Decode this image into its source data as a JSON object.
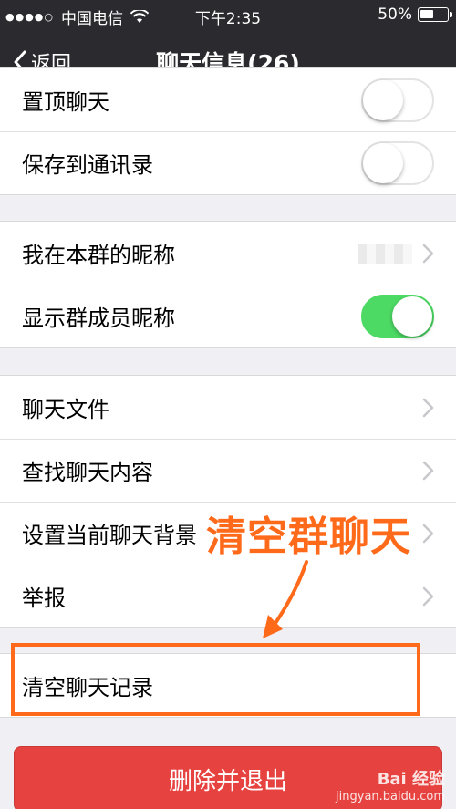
{
  "status_bar": {
    "carrier": "中国电信",
    "time": "下午2:35",
    "battery": "50%",
    "battery_level": 0.5
  },
  "nav": {
    "back_label": "返回",
    "title": "聊天信息(26)"
  },
  "section1": [
    {
      "label": "置顶聊天",
      "control": "toggle",
      "on": false
    },
    {
      "label": "保存到通讯录",
      "control": "toggle",
      "on": false
    }
  ],
  "section2": [
    {
      "label": "我在本群的昵称",
      "control": "chevron"
    },
    {
      "label": "显示群成员昵称",
      "control": "toggle",
      "on": true
    }
  ],
  "section3": [
    {
      "label": "聊天文件",
      "control": "chevron"
    },
    {
      "label": "查找聊天内容",
      "control": "chevron"
    },
    {
      "label": "设置当前聊天背景",
      "control": "chevron"
    },
    {
      "label": "举报",
      "control": "chevron"
    }
  ],
  "section4": [
    {
      "label": "清空聊天记录"
    }
  ],
  "annotation": {
    "text": "清空群聊天",
    "color": "#ff6a1a"
  },
  "delete_button": {
    "label": "删除并退出",
    "color": "#e64340"
  },
  "toggle_on_color": "#4cd964",
  "watermark": {
    "brand": "Bai 经验",
    "url": "jingyan.baidu.com"
  }
}
